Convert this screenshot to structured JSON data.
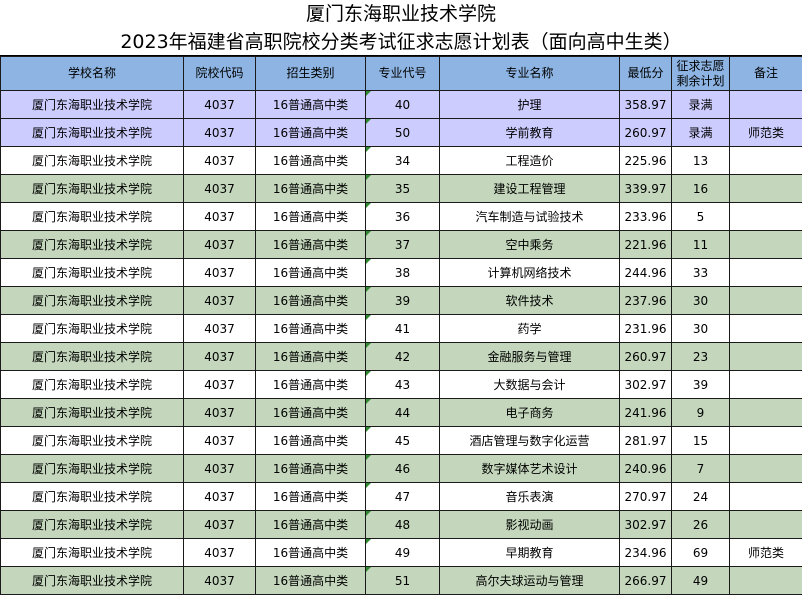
{
  "title": "厦门东海职业技术学院",
  "subtitle": "2023年福建省高职院校分类考试征求志愿计划表（面向高中生类）",
  "headers": {
    "school": "学校名称",
    "school_code": "院校代码",
    "category": "招生类别",
    "major_code": "专业代号",
    "major_name": "专业名称",
    "min_score": "最低分",
    "remaining": "征求志愿剩余计划",
    "note": "备注"
  },
  "rows": [
    {
      "school": "厦门东海职业技术学院",
      "school_code": "4037",
      "category": "16普通高中类",
      "major_code": "40",
      "major_name": "护理",
      "min_score": "358.97",
      "remaining": "录满",
      "note": "",
      "color": "#ccccff"
    },
    {
      "school": "厦门东海职业技术学院",
      "school_code": "4037",
      "category": "16普通高中类",
      "major_code": "50",
      "major_name": "学前教育",
      "min_score": "260.97",
      "remaining": "录满",
      "note": "师范类",
      "color": "#ccccff"
    },
    {
      "school": "厦门东海职业技术学院",
      "school_code": "4037",
      "category": "16普通高中类",
      "major_code": "34",
      "major_name": "工程造价",
      "min_score": "225.96",
      "remaining": "13",
      "note": "",
      "color": "#ffffff"
    },
    {
      "school": "厦门东海职业技术学院",
      "school_code": "4037",
      "category": "16普通高中类",
      "major_code": "35",
      "major_name": "建设工程管理",
      "min_score": "339.97",
      "remaining": "16",
      "note": "",
      "color": "#c4d7bc"
    },
    {
      "school": "厦门东海职业技术学院",
      "school_code": "4037",
      "category": "16普通高中类",
      "major_code": "36",
      "major_name": "汽车制造与试验技术",
      "min_score": "233.96",
      "remaining": "5",
      "note": "",
      "color": "#ffffff"
    },
    {
      "school": "厦门东海职业技术学院",
      "school_code": "4037",
      "category": "16普通高中类",
      "major_code": "37",
      "major_name": "空中乘务",
      "min_score": "221.96",
      "remaining": "11",
      "note": "",
      "color": "#c4d7bc"
    },
    {
      "school": "厦门东海职业技术学院",
      "school_code": "4037",
      "category": "16普通高中类",
      "major_code": "38",
      "major_name": "计算机网络技术",
      "min_score": "244.96",
      "remaining": "33",
      "note": "",
      "color": "#ffffff"
    },
    {
      "school": "厦门东海职业技术学院",
      "school_code": "4037",
      "category": "16普通高中类",
      "major_code": "39",
      "major_name": "软件技术",
      "min_score": "237.96",
      "remaining": "30",
      "note": "",
      "color": "#c4d7bc"
    },
    {
      "school": "厦门东海职业技术学院",
      "school_code": "4037",
      "category": "16普通高中类",
      "major_code": "41",
      "major_name": "药学",
      "min_score": "231.96",
      "remaining": "30",
      "note": "",
      "color": "#ffffff"
    },
    {
      "school": "厦门东海职业技术学院",
      "school_code": "4037",
      "category": "16普通高中类",
      "major_code": "42",
      "major_name": "金融服务与管理",
      "min_score": "260.97",
      "remaining": "23",
      "note": "",
      "color": "#c4d7bc"
    },
    {
      "school": "厦门东海职业技术学院",
      "school_code": "4037",
      "category": "16普通高中类",
      "major_code": "43",
      "major_name": "大数据与会计",
      "min_score": "302.97",
      "remaining": "39",
      "note": "",
      "color": "#ffffff"
    },
    {
      "school": "厦门东海职业技术学院",
      "school_code": "4037",
      "category": "16普通高中类",
      "major_code": "44",
      "major_name": "电子商务",
      "min_score": "241.96",
      "remaining": "9",
      "note": "",
      "color": "#c4d7bc"
    },
    {
      "school": "厦门东海职业技术学院",
      "school_code": "4037",
      "category": "16普通高中类",
      "major_code": "45",
      "major_name": "酒店管理与数字化运营",
      "min_score": "281.97",
      "remaining": "15",
      "note": "",
      "color": "#ffffff"
    },
    {
      "school": "厦门东海职业技术学院",
      "school_code": "4037",
      "category": "16普通高中类",
      "major_code": "46",
      "major_name": "数字媒体艺术设计",
      "min_score": "240.96",
      "remaining": "7",
      "note": "",
      "color": "#c4d7bc"
    },
    {
      "school": "厦门东海职业技术学院",
      "school_code": "4037",
      "category": "16普通高中类",
      "major_code": "47",
      "major_name": "音乐表演",
      "min_score": "270.97",
      "remaining": "24",
      "note": "",
      "color": "#ffffff"
    },
    {
      "school": "厦门东海职业技术学院",
      "school_code": "4037",
      "category": "16普通高中类",
      "major_code": "48",
      "major_name": "影视动画",
      "min_score": "302.97",
      "remaining": "26",
      "note": "",
      "color": "#c4d7bc"
    },
    {
      "school": "厦门东海职业技术学院",
      "school_code": "4037",
      "category": "16普通高中类",
      "major_code": "49",
      "major_name": "早期教育",
      "min_score": "234.96",
      "remaining": "69",
      "note": "师范类",
      "color": "#ffffff"
    },
    {
      "school": "厦门东海职业技术学院",
      "school_code": "4037",
      "category": "16普通高中类",
      "major_code": "51",
      "major_name": "高尔夫球运动与管理",
      "min_score": "266.97",
      "remaining": "49",
      "note": "",
      "color": "#c4d7bc"
    }
  ]
}
